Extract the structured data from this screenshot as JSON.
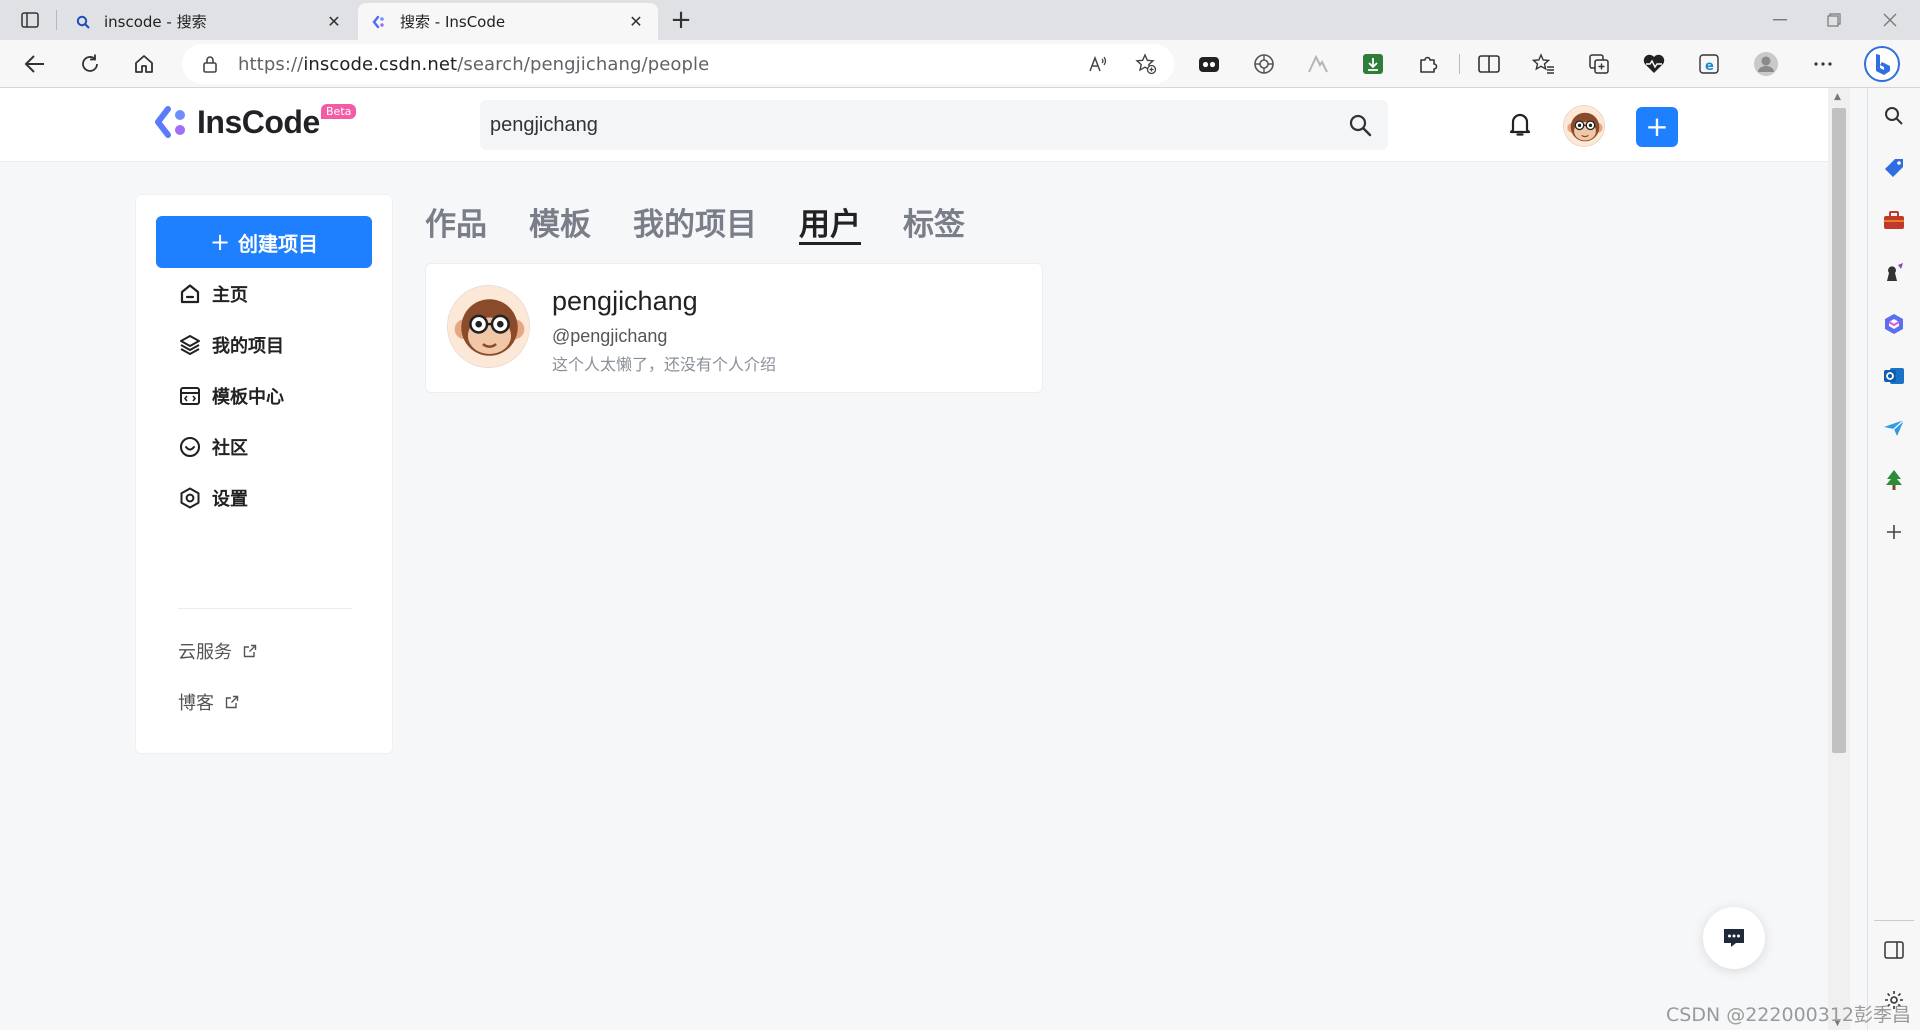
{
  "browser": {
    "tabs": [
      {
        "title": "inscode - 搜索",
        "favicon": "search-favicon"
      },
      {
        "title": "搜索 - InsCode",
        "favicon": "inscode-favicon",
        "active": true
      }
    ],
    "new_tab": "+",
    "url_prefix": "https://",
    "url_host": "inscode.csdn.net",
    "url_path": "/search/pengjichang/people"
  },
  "header": {
    "logo_text": "InsCode",
    "beta_badge": "Beta",
    "search_value": "pengjichang",
    "plus": "+"
  },
  "sidebar": {
    "create_button": "创建项目",
    "create_plus": "+",
    "items": [
      {
        "label": "主页",
        "icon": "home-icon"
      },
      {
        "label": "我的项目",
        "icon": "layers-icon"
      },
      {
        "label": "模板中心",
        "icon": "template-icon"
      },
      {
        "label": "社区",
        "icon": "community-icon"
      },
      {
        "label": "设置",
        "icon": "settings-icon"
      }
    ],
    "external_links": [
      {
        "label": "云服务",
        "icon": "external-link-icon"
      },
      {
        "label": "博客",
        "icon": "external-link-icon"
      }
    ]
  },
  "tabs": [
    {
      "label": "作品",
      "active": false
    },
    {
      "label": "模板",
      "active": false
    },
    {
      "label": "我的项目",
      "active": false
    },
    {
      "label": "用户",
      "active": true
    },
    {
      "label": "标签",
      "active": false
    }
  ],
  "user_result": {
    "name": "pengjichang",
    "handle": "@pengjichang",
    "bio": "这个人太懒了，还没有个人介绍"
  },
  "watermark": "CSDN @222000312彭季昌",
  "colors": {
    "accent": "#1e80ff",
    "beta": "#f45ba5",
    "page_bg": "#f6f7f9"
  }
}
